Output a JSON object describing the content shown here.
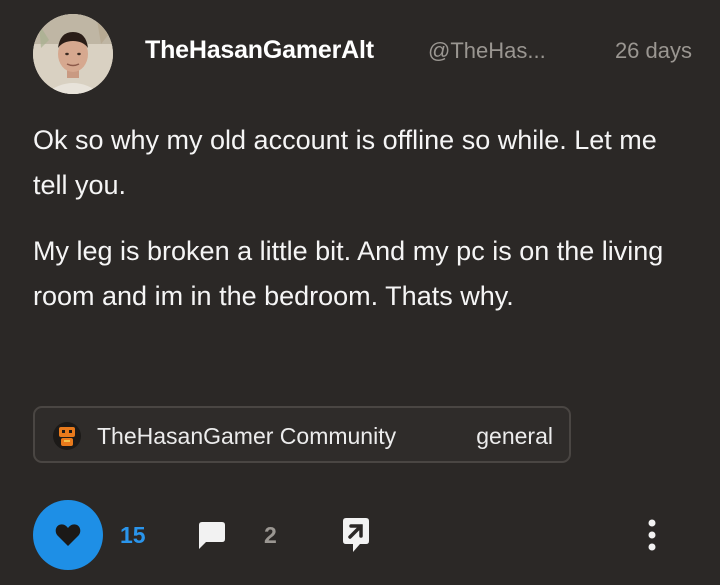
{
  "post": {
    "author": {
      "display_name": "TheHasanGamerAlt",
      "handle": "@TheHas..."
    },
    "timestamp": "26 days",
    "body": [
      "Ok so why my old account is offline so while. Let me tell you.",
      "My leg is broken a little bit. And my pc is on the living room and im in the bedroom. Thats why."
    ],
    "community": {
      "name": "TheHasanGamer Community",
      "channel": "general"
    }
  },
  "actions": {
    "like_count": "15",
    "reply_count": "2"
  },
  "colors": {
    "background": "#2b2826",
    "accent": "#1e8fe6",
    "muted_text": "#9a9691"
  },
  "icons": {
    "like": "heart-icon",
    "reply": "speech-bubble-icon",
    "share": "share-icon",
    "more": "vertical-ellipsis-icon",
    "community": "community-avatar-icon"
  }
}
